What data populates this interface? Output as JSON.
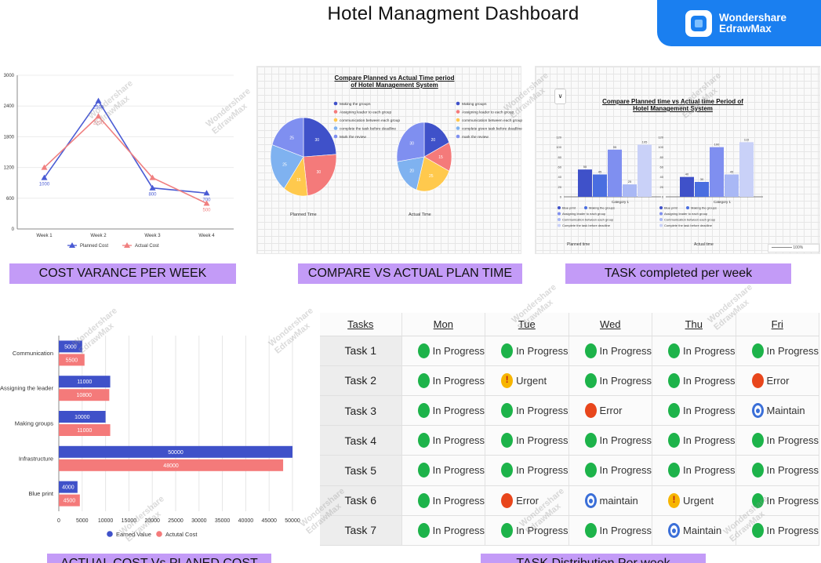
{
  "header": {
    "title": "Hotel Managment Dashboard"
  },
  "brand": {
    "line1": "Wondershare",
    "line2": "EdrawMax"
  },
  "panels": {
    "cost_variance_label": "COST VARANCE PER WEEK",
    "compare_label": "COMPARE VS ACTUAL PLAN TIME",
    "tasks_label": "TASK completed per week",
    "actual_cost_label": "ACTUAL COST  Vs PLANED COST",
    "distribution_label": "TASK Distribution Per week"
  },
  "watermark": {
    "line1": "Wondershare",
    "line2": "EdrawMax"
  },
  "chart_data": [
    {
      "type": "line",
      "categories": [
        "Week 1",
        "Week 2",
        "Week 3",
        "Week 4"
      ],
      "series": [
        {
          "name": "Planned Cost",
          "values": [
            1000,
            2500,
            800,
            700
          ],
          "color": "#4a5bd4"
        },
        {
          "name": "Actual Cost",
          "values": [
            1200,
            2200,
            1000,
            500
          ],
          "color": "#f08080"
        }
      ],
      "data_labels": {
        "planned": [
          "1000",
          "2500",
          "800",
          "700"
        ],
        "actual": [
          "",
          "2200",
          "",
          "500"
        ]
      },
      "yticks": [
        "0",
        "600",
        "1200",
        "1800",
        "2400",
        "3000"
      ],
      "ylim": [
        0,
        3000
      ]
    },
    {
      "type": "pie",
      "title": "Compare Planned vs Actual Time period of Hotel Management System",
      "charts": [
        {
          "caption": "Planned Time",
          "values": [
            30,
            30,
            15,
            25,
            25
          ],
          "labels": [
            "30",
            "30",
            "15",
            "25",
            "25"
          ]
        },
        {
          "caption": "Actual Time",
          "values": [
            20,
            15,
            25,
            20,
            30
          ],
          "labels": [
            "20",
            "15",
            "25",
            "20",
            "30"
          ]
        }
      ],
      "legend_left": [
        "Making the groups",
        "Assigning leader to each group",
        "communication between each group",
        "complete the task before deadline",
        "Mark the review"
      ],
      "legend_right": [
        "Making groups",
        "Assigning leader to each group",
        "communication between each group",
        "complete given task before deadline",
        "mark the review"
      ],
      "colors": [
        "#3f51c9",
        "#f47a7a",
        "#ffc94d",
        "#7fb2f0",
        "#7f8ff0"
      ]
    },
    {
      "type": "bar",
      "title": "Compare Planned time vs Actual time Period of Hotel Management System",
      "groups": [
        {
          "caption": "Planned time",
          "category": "Category 1",
          "values": [
            55,
            45,
            95,
            25,
            105
          ],
          "labels": [
            "55",
            "45",
            "95",
            "25",
            "105"
          ]
        },
        {
          "caption": "Actual time",
          "category": "Category 1",
          "values": [
            40,
            30,
            100,
            45,
            110
          ],
          "labels": [
            "40",
            "30",
            "100",
            "45",
            "110"
          ]
        }
      ],
      "legend": [
        "Blue print",
        "Making the groups",
        "Assigning leader to each group",
        "Communication between each group",
        "Complete the task before deadline"
      ],
      "colors": [
        "#3f51c9",
        "#4a6ee0",
        "#7f8ff0",
        "#a9b8f5",
        "#c9d1f8"
      ],
      "yticks": [
        "0",
        "20",
        "40",
        "60",
        "80",
        "100",
        "120"
      ],
      "ylim": [
        0,
        120
      ],
      "zoom": "100%"
    },
    {
      "type": "bar",
      "orientation": "horizontal",
      "categories": [
        "Communication",
        "Assigning the leader",
        "Making groups",
        "Infrastructure",
        "Blue print"
      ],
      "series": [
        {
          "name": "Earned Value",
          "values": [
            5000,
            11000,
            10000,
            50000,
            4000
          ],
          "color": "#3f51c9"
        },
        {
          "name": "Actutal Cost",
          "values": [
            5500,
            10800,
            11000,
            48000,
            4500
          ],
          "color": "#f47a7a"
        }
      ],
      "xticks": [
        "0",
        "5000",
        "10000",
        "15000",
        "20000",
        "25000",
        "30000",
        "35000",
        "40000",
        "45000",
        "50000"
      ],
      "xlim": [
        0,
        50000
      ]
    }
  ],
  "table": {
    "headers": [
      "Tasks",
      "Mon",
      "Tue",
      "Wed",
      "Thu",
      "Fri"
    ],
    "rows": [
      {
        "task": "Task 1",
        "cells": [
          [
            "In Progress",
            "green"
          ],
          [
            "In Progress",
            "green"
          ],
          [
            "In Progress",
            "green"
          ],
          [
            "In Progress",
            "green"
          ],
          [
            "In Progress",
            "green"
          ]
        ]
      },
      {
        "task": "Task 2",
        "cells": [
          [
            "In Progress",
            "green"
          ],
          [
            "Urgent",
            "yellow"
          ],
          [
            "In Progress",
            "green"
          ],
          [
            "In Progress",
            "green"
          ],
          [
            "Error",
            "red"
          ]
        ]
      },
      {
        "task": "Task 3",
        "cells": [
          [
            "In Progress",
            "green"
          ],
          [
            "In Progress",
            "green"
          ],
          [
            "Error",
            "red"
          ],
          [
            "In Progress",
            "green"
          ],
          [
            "Maintain",
            "blue"
          ]
        ]
      },
      {
        "task": "Task 4",
        "cells": [
          [
            "In Progress",
            "green"
          ],
          [
            "In Progress",
            "green"
          ],
          [
            "In Progress",
            "green"
          ],
          [
            "In Progress",
            "green"
          ],
          [
            "In Progress",
            "green"
          ]
        ]
      },
      {
        "task": "Task 5",
        "cells": [
          [
            "In Progress",
            "green"
          ],
          [
            "In Progress",
            "green"
          ],
          [
            "In Progress",
            "green"
          ],
          [
            "In Progress",
            "green"
          ],
          [
            "In Progress",
            "green"
          ]
        ]
      },
      {
        "task": "Task 6",
        "cells": [
          [
            "In Progress",
            "green"
          ],
          [
            "Error",
            "red"
          ],
          [
            "maintain",
            "blue"
          ],
          [
            "Urgent",
            "yellow"
          ],
          [
            "In Progress",
            "green"
          ]
        ]
      },
      {
        "task": "Task 7",
        "cells": [
          [
            "In Progress",
            "green"
          ],
          [
            "In Progress",
            "green"
          ],
          [
            "In Progress",
            "green"
          ],
          [
            "Maintain",
            "blue"
          ],
          [
            "In Progress",
            "green"
          ]
        ]
      }
    ]
  }
}
